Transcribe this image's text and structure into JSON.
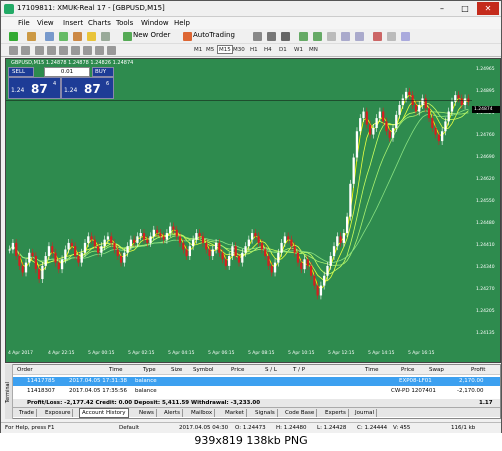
{
  "window": {
    "title": "17109811: XMUK-Real 17 - [GBPUSD,M15]",
    "minimize": "–",
    "maximize": "□",
    "close": "✕"
  },
  "menu": [
    "File",
    "View",
    "Insert",
    "Charts",
    "Tools",
    "Window",
    "Help"
  ],
  "toolbar": {
    "new_order": "New Order",
    "autotrading": "AutoTrading"
  },
  "timeframes": [
    "M1",
    "M5",
    "M15",
    "M30",
    "H1",
    "H4",
    "D1",
    "W1",
    "MN"
  ],
  "chart": {
    "header": "GBPUSD,M15  1.24878 1.24878 1.24826 1.24874",
    "sell_label": "SELL",
    "buy_label": "BUY",
    "lot": "0.01",
    "sell_prefix": "1.24",
    "sell_big": "87",
    "sell_sup": "4",
    "buy_prefix": "1.24",
    "buy_big": "87",
    "buy_sup": "6",
    "current_price": "1.24874",
    "colors": {
      "background": "#2e8b4e",
      "bull": "#ffffff",
      "bear": "#d42020",
      "ma": [
        "#ffff00",
        "#e8ff40",
        "#c8ff60",
        "#a8f070",
        "#88e080"
      ]
    }
  },
  "chart_data": {
    "type": "candlestick",
    "y_ticks": [
      "1.24965",
      "1.24895",
      "1.24825",
      "1.24760",
      "1.24690",
      "1.24620",
      "1.24550",
      "1.24480",
      "1.24410",
      "1.24340",
      "1.24270",
      "1.24205",
      "1.24135"
    ],
    "x_ticks": [
      "4 Apr 2017",
      "4 Apr 22:15",
      "5 Apr 00:15",
      "5 Apr 02:15",
      "5 Apr 04:15",
      "5 Apr 06:15",
      "5 Apr 08:15",
      "5 Apr 10:15",
      "5 Apr 12:15",
      "5 Apr 14:15",
      "5 Apr 16:15"
    ],
    "closes": [
      1.2442,
      1.2444,
      1.244,
      1.2437,
      1.2435,
      1.2438,
      1.2441,
      1.244,
      1.2436,
      1.2433,
      1.2437,
      1.244,
      1.2443,
      1.2441,
      1.2438,
      1.2436,
      1.2439,
      1.2442,
      1.2444,
      1.2443,
      1.244,
      1.2438,
      1.2441,
      1.2444,
      1.2446,
      1.2445,
      1.2443,
      1.2441,
      1.2443,
      1.2445,
      1.2446,
      1.2444,
      1.2442,
      1.244,
      1.2438,
      1.2441,
      1.2443,
      1.2445,
      1.2444,
      1.2446,
      1.2447,
      1.2445,
      1.2444,
      1.2446,
      1.2448,
      1.2447,
      1.2446,
      1.2445,
      1.2447,
      1.2449,
      1.2448,
      1.2446,
      1.2444,
      1.2442,
      1.244,
      1.2443,
      1.2445,
      1.2447,
      1.2446,
      1.2444,
      1.2442,
      1.244,
      1.2442,
      1.2444,
      1.2441,
      1.2439,
      1.2437,
      1.244,
      1.2443,
      1.244,
      1.2438,
      1.2441,
      1.2443,
      1.2445,
      1.2447,
      1.2446,
      1.2444,
      1.2442,
      1.244,
      1.2437,
      1.2435,
      1.2438,
      1.2441,
      1.2444,
      1.2446,
      1.2445,
      1.2443,
      1.2441,
      1.2438,
      1.2436,
      1.2439,
      1.2437,
      1.2434,
      1.2431,
      1.2428,
      1.2431,
      1.2434,
      1.2437,
      1.244,
      1.2443,
      1.2446,
      1.2444,
      1.2447,
      1.2452,
      1.2462,
      1.247,
      1.2478,
      1.2482,
      1.2484,
      1.248,
      1.2477,
      1.2479,
      1.2482,
      1.2484,
      1.2481,
      1.2478,
      1.2476,
      1.2479,
      1.2483,
      1.2486,
      1.2488,
      1.249,
      1.2489,
      1.2486,
      1.2484,
      1.2486,
      1.2488,
      1.2485,
      1.2482,
      1.2479,
      1.2477,
      1.2475,
      1.2478,
      1.2481,
      1.2484,
      1.2487,
      1.2489,
      1.2488,
      1.2486,
      1.2488,
      1.2487
    ],
    "ylim": [
      1.2412,
      1.25
    ]
  },
  "terminal": {
    "side_label": "Terminal",
    "columns": [
      "Order",
      "Time",
      "Type",
      "Size",
      "Symbol",
      "Price",
      "S / L",
      "T / P",
      "Time",
      "Price",
      "Swap",
      "Profit"
    ],
    "rows": [
      {
        "order": "11417785",
        "time": "2017.04.05 17:31:38",
        "type": "balance",
        "comment": "EXP08-LF01",
        "profit": "2,170.00"
      },
      {
        "order": "11418307",
        "time": "2017.04.05 17:35:56",
        "type": "balance",
        "comment": "CW-PD 1207401",
        "profit": "-2,170.00"
      }
    ],
    "summary": "Profit/Loss: -2,177.42  Credit: 0.00  Deposit: 5,411.59  Withdrawal: -3,233.00",
    "summary_right": "1.17",
    "tabs": [
      "Trade",
      "Exposure",
      "Account History",
      "News",
      "Alerts",
      "Mailbox",
      "Market",
      "Signals",
      "Code Base",
      "Experts",
      "Journal"
    ],
    "active_tab": "Account History"
  },
  "status": {
    "help": "For Help, press F1",
    "profile": "Default",
    "time": "2017.04.05 04:30",
    "o": "O: 1.24473",
    "h": "H: 1.24480",
    "l": "L: 1.24428",
    "c": "C: 1.24444",
    "v": "V: 455",
    "conn": "116/1 kb"
  },
  "caption": "939x819  138kb  PNG"
}
